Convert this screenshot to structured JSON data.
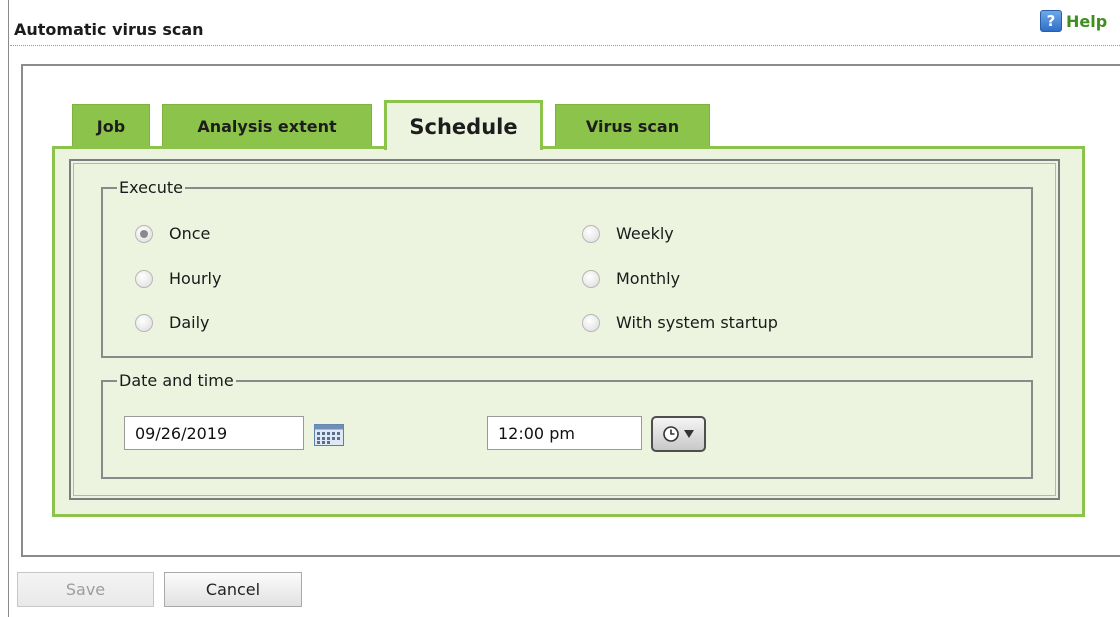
{
  "header": {
    "title": "Automatic virus scan",
    "help_label": "Help",
    "help_icon_glyph": "?"
  },
  "tabs": [
    {
      "label": "Job",
      "active": false
    },
    {
      "label": "Analysis extent",
      "active": false
    },
    {
      "label": "Schedule",
      "active": true
    },
    {
      "label": "Virus scan",
      "active": false
    }
  ],
  "execute": {
    "legend": "Execute",
    "options": [
      {
        "label": "Once",
        "selected": true
      },
      {
        "label": "Hourly",
        "selected": false
      },
      {
        "label": "Daily",
        "selected": false
      },
      {
        "label": "Weekly",
        "selected": false
      },
      {
        "label": "Monthly",
        "selected": false
      },
      {
        "label": "With system startup",
        "selected": false
      }
    ]
  },
  "date_time": {
    "legend": "Date and time",
    "date_value": "09/26/2019",
    "time_value": "12:00 pm",
    "calendar_icon": "calendar-icon",
    "clock_icon": "clock-dropdown-icon"
  },
  "buttons": {
    "save_label": "Save",
    "cancel_label": "Cancel",
    "save_enabled": false
  },
  "colors": {
    "tab_green": "#8cc34a",
    "panel_bg": "#ecf4e0",
    "help_green": "#3f8f1e"
  }
}
